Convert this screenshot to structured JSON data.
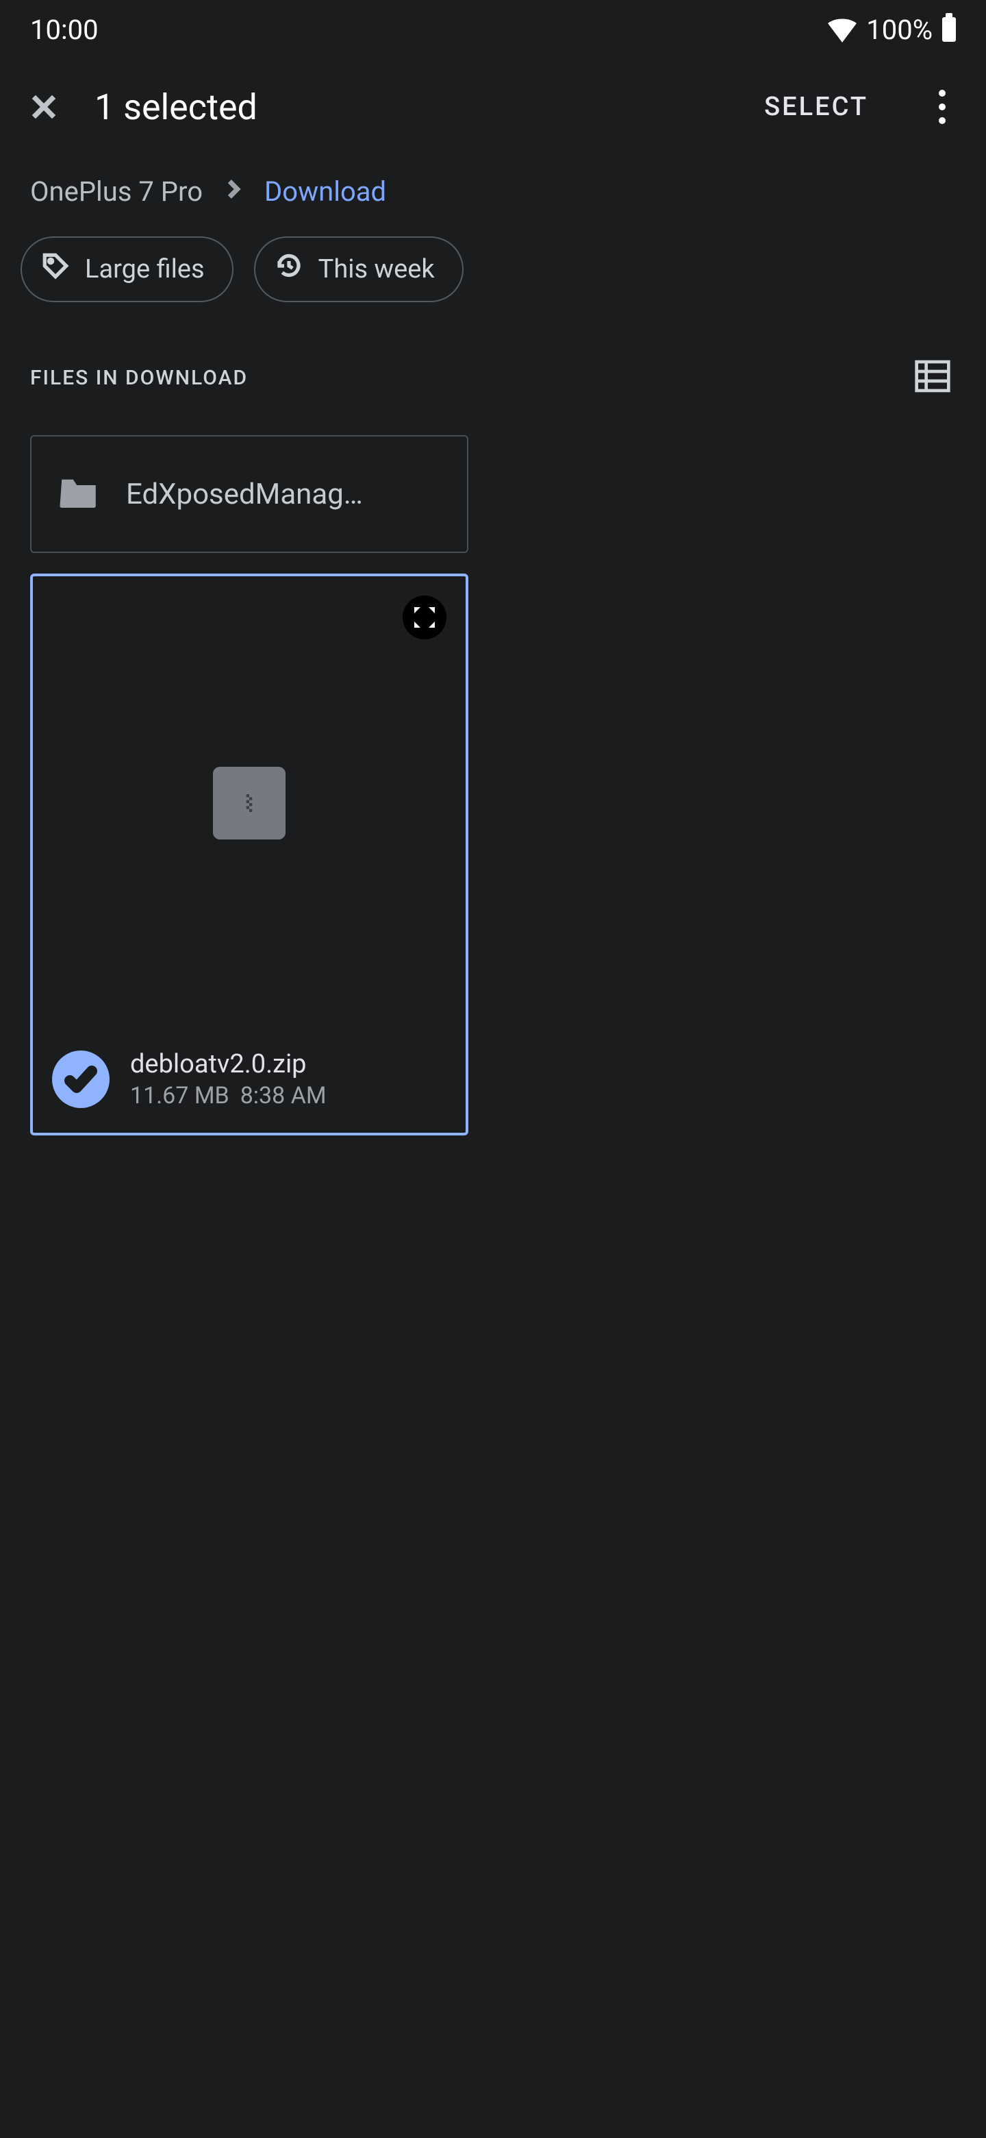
{
  "statusbar": {
    "time": "10:00",
    "battery": "100%"
  },
  "appbar": {
    "title": "1 selected",
    "select_label": "SELECT"
  },
  "breadcrumbs": {
    "root": "OnePlus 7 Pro",
    "current": "Download"
  },
  "chips": {
    "large_files": "Large files",
    "this_week": "This week"
  },
  "section": {
    "label": "FILES IN DOWNLOAD"
  },
  "folder": {
    "name": "EdXposedManag…"
  },
  "file": {
    "name": "debloatv2.0.zip",
    "size": "11.67 MB",
    "time": "8:38 AM"
  }
}
